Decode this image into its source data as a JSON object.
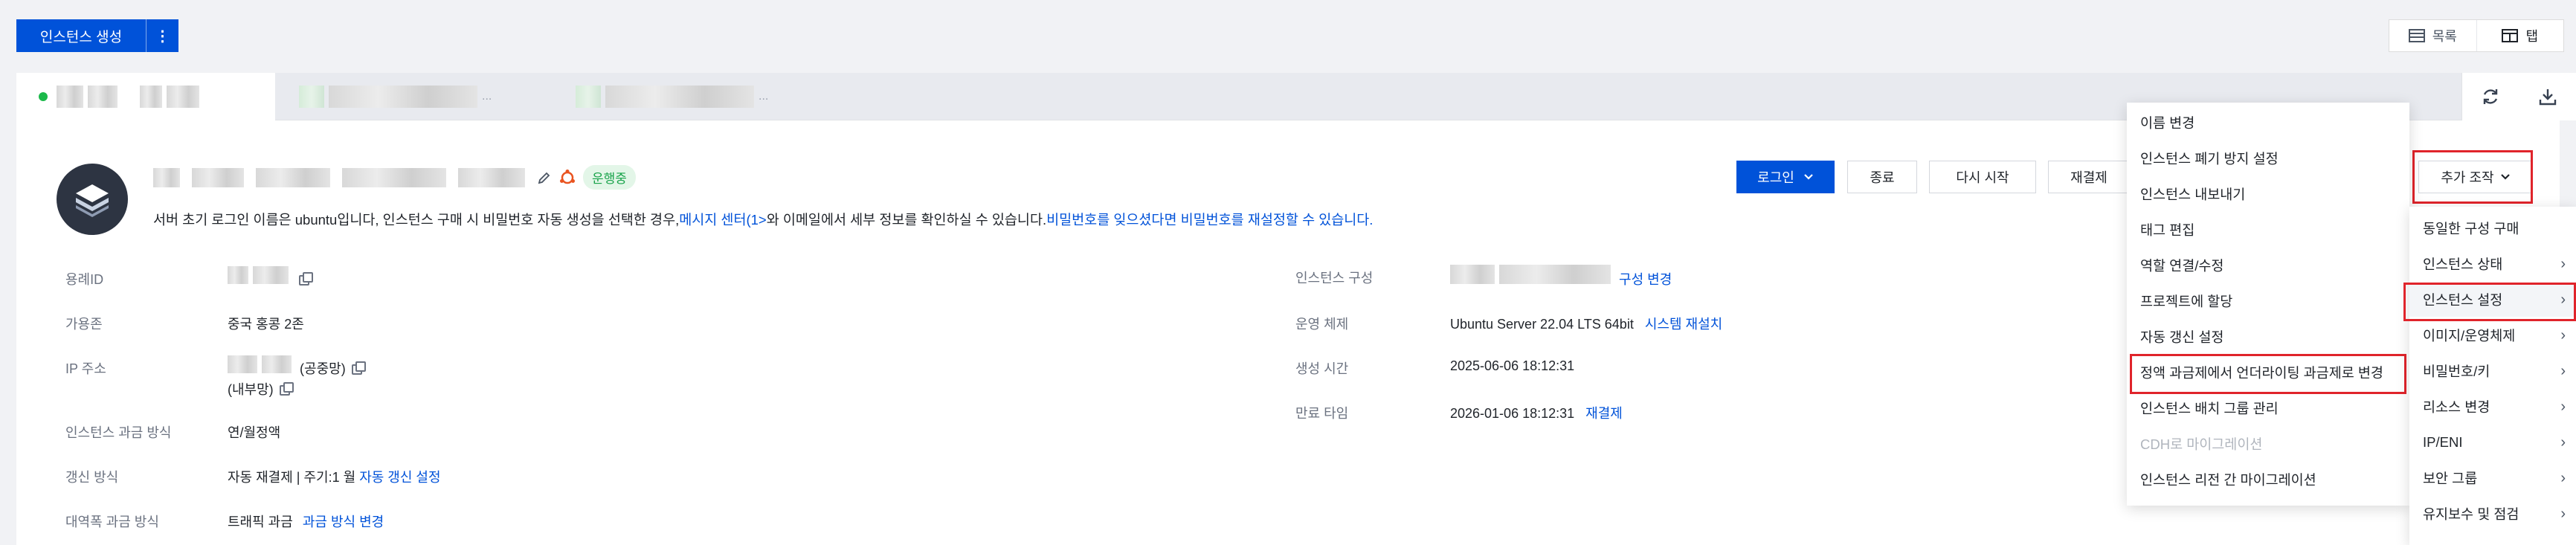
{
  "toolbar": {
    "create_label": "인스턴스 생성",
    "more_label": "⋮"
  },
  "view_toggle": {
    "list_label": "목록",
    "tab_label": "탭"
  },
  "tabs": {
    "ellipsis_1": "...",
    "ellipsis_2": "..."
  },
  "tab_tools": {
    "refresh_icon": "refresh-icon",
    "download_icon": "download-icon"
  },
  "instance": {
    "status": "운행중",
    "status_color": "#18a34a",
    "notice_prefix": "서버 초기 로그인 이름은 ubuntu입니다, 인스턴스 구매 시 비밀번호 자동 생성을 선택한 경우,",
    "notice_link1": "메시지 센터(1>",
    "notice_middle": "와 이메일에서 세부 정보를 확인하실 수 있습니다.",
    "notice_link2": "비밀번호를 잊으셨다면 비밀번호를 재설정할 수 있습니다."
  },
  "actions": {
    "login": "로그인",
    "stop": "종료",
    "restart": "다시 시작",
    "pay": "재결제",
    "more_ops": "추가 조작"
  },
  "info_left": {
    "id_label": "용례ID",
    "zone_label": "가용존",
    "zone_value": "중국 홍콩 2존",
    "ip_label": "IP 주소",
    "ip_public": "(공중망)",
    "ip_private": "(내부망)",
    "billing_label": "인스턴스 과금 방식",
    "billing_value": "연/월정액",
    "renew_label": "갱신 방식",
    "renew_value": "자동 재결제 | 주기:1 월",
    "renew_link": "자동 갱신 설정",
    "bw_label": "대역폭 과금 방식",
    "bw_value": "트래픽 과금",
    "bw_link": "과금 방식 변경"
  },
  "info_right": {
    "config_label": "인스턴스 구성",
    "config_link": "구성 변경",
    "os_label": "운영 체제",
    "os_value": "Ubuntu Server 22.04 LTS 64bit",
    "os_link": "시스템 재설치",
    "created_label": "생성 시간",
    "created_value": "2025-06-06 18:12:31",
    "expire_label": "만료 타임",
    "expire_value": "2026-01-06 18:12:31",
    "expire_link": "재결제"
  },
  "submenu": {
    "items": [
      "이름 변경",
      "인스턴스 폐기 방지 설정",
      "인스턴스 내보내기",
      "태그 편집",
      "역할 연결/수정",
      "프로젝트에 할당",
      "자동 갱신 설정",
      "정액 과금제에서 언더라이팅 과금제로 변경",
      "인스턴스 배치 그룹 관리",
      "CDH로 마이그레이션",
      "인스턴스 리전 간 마이그레이션"
    ]
  },
  "more_menu": {
    "items": [
      "동일한 구성 구매",
      "인스턴스 상태",
      "인스턴스 설정",
      "이미지/운영체제",
      "비밀번호/키",
      "리소스 변경",
      "IP/ENI",
      "보안 그룹",
      "유지보수 및 점검"
    ]
  }
}
